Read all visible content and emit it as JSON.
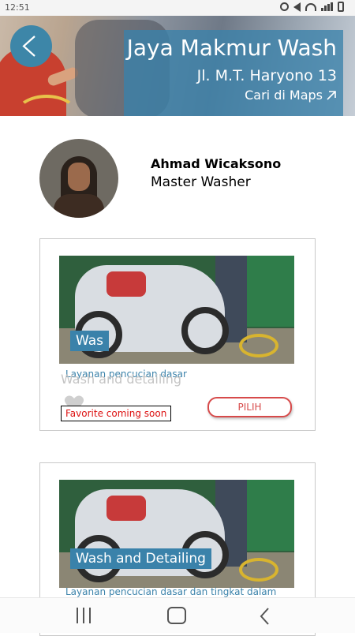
{
  "status_bar": {
    "time": "12:51"
  },
  "header": {
    "title": "Jaya Makmur Wash",
    "address": "Jl. M.T. Haryono 13",
    "maps_link": "Cari di Maps"
  },
  "worker": {
    "name": "Ahmad Wicaksono",
    "role": "Master Washer"
  },
  "services": [
    {
      "label": "Was",
      "description": "Layanan pencucian dasar",
      "ghost_text": "Wash and detailing",
      "favorite_note": "Favorite coming soon",
      "button_label": "PILIH"
    },
    {
      "label": "Wash and Detailing",
      "description": "Layanan pencucian dasar dan tingkat dalam"
    }
  ],
  "icons": {
    "back": "chevron-left-icon",
    "maps": "arrow-up-right-icon",
    "favorite": "heart-icon",
    "nav": [
      "recent-apps-icon",
      "home-icon",
      "back-icon"
    ]
  },
  "colors": {
    "accent": "#3a82aa",
    "button": "#d74a4a",
    "note_text": "#dd1111"
  }
}
